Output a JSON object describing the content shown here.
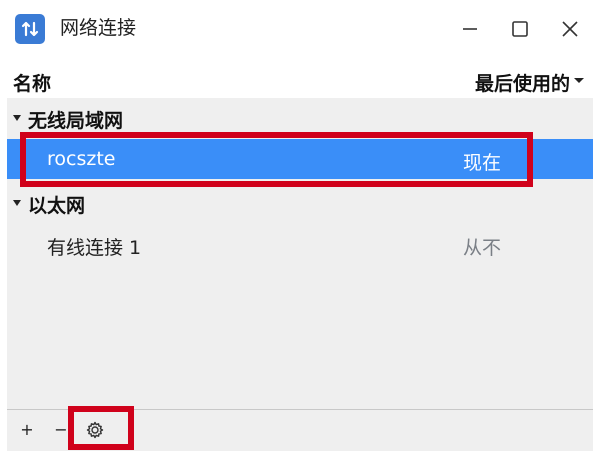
{
  "window": {
    "title": "网络连接"
  },
  "icons": {
    "app": "network-transfer-icon",
    "minimize": "minimize-icon",
    "maximize": "maximize-icon",
    "close": "close-icon",
    "settings": "gear-icon"
  },
  "columns": {
    "name": "名称",
    "last_used": "最后使用的"
  },
  "groups": [
    {
      "label": "无线局域网",
      "connections": [
        {
          "name": "rocszte",
          "last_used": "现在",
          "selected": true
        }
      ]
    },
    {
      "label": "以太网",
      "connections": [
        {
          "name": "有线连接 1",
          "last_used": "从不",
          "selected": false
        }
      ]
    }
  ],
  "toolbar": {
    "add_label": "+",
    "remove_label": "−"
  },
  "colors": {
    "selection": "#3a8ef8",
    "highlight": "#d0011b",
    "app_icon": "#3a7bd5"
  }
}
